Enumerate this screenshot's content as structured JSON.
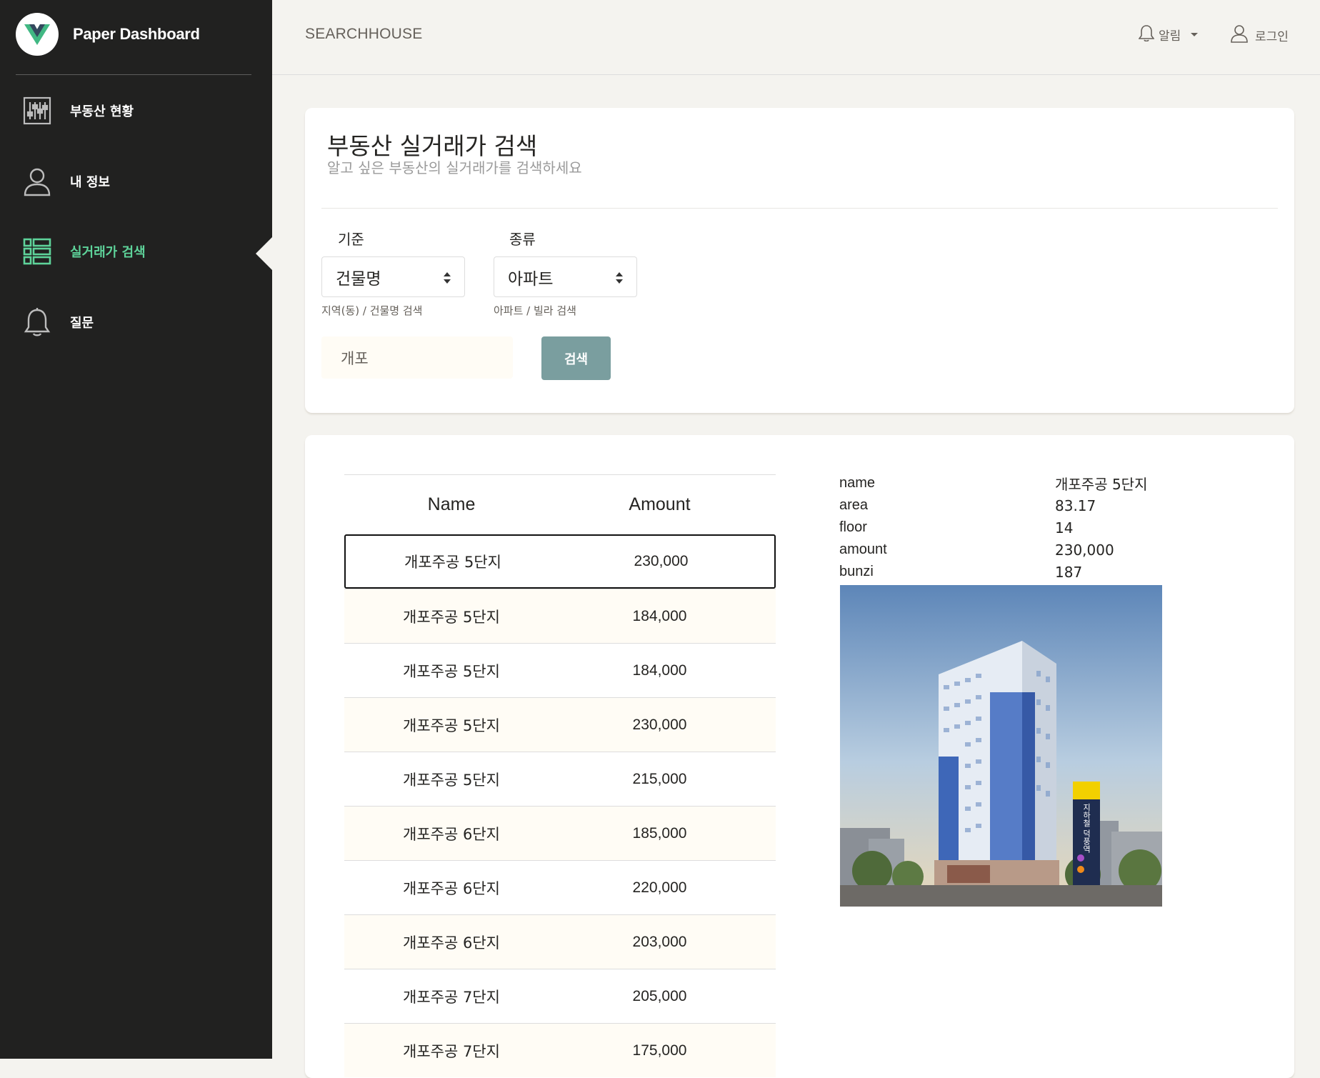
{
  "sidebar": {
    "brand": "Paper Dashboard",
    "items": [
      {
        "label": "부동산 현황",
        "icon": "dashboard-sliders-icon"
      },
      {
        "label": "내 정보",
        "icon": "user-icon"
      },
      {
        "label": "실거래가 검색",
        "icon": "list-icon"
      },
      {
        "label": "질문",
        "icon": "bell-icon"
      }
    ],
    "active_index": 2,
    "active_color": "#5ed39a"
  },
  "topbar": {
    "brand": "SEARCHHOUSE",
    "alarm_label": "알림",
    "login_label": "로그인"
  },
  "search_card": {
    "title": "부동산 실거래가 검색",
    "subtitle": "알고 싶은 부동산의 실거래가를 검색하세요",
    "criteria_label": "기준",
    "criteria_value": "건물명",
    "criteria_hint": "지역(동) / 건물명 검색",
    "type_label": "종류",
    "type_value": "아파트",
    "type_hint": "아파트 / 빌라 검색",
    "search_value": "개포",
    "search_button": "검색",
    "button_color": "#7a9e9f"
  },
  "results": {
    "headers": {
      "name": "Name",
      "amount": "Amount"
    },
    "rows": [
      {
        "name": "개포주공 5단지",
        "amount": "230,000"
      },
      {
        "name": "개포주공 5단지",
        "amount": "184,000"
      },
      {
        "name": "개포주공 5단지",
        "amount": "184,000"
      },
      {
        "name": "개포주공 5단지",
        "amount": "230,000"
      },
      {
        "name": "개포주공 5단지",
        "amount": "215,000"
      },
      {
        "name": "개포주공 6단지",
        "amount": "185,000"
      },
      {
        "name": "개포주공 6단지",
        "amount": "220,000"
      },
      {
        "name": "개포주공 6단지",
        "amount": "203,000"
      },
      {
        "name": "개포주공 7단지",
        "amount": "205,000"
      },
      {
        "name": "개포주공 7단지",
        "amount": "175,000"
      }
    ],
    "selected_index": 0
  },
  "details": {
    "rows": [
      {
        "key": "name",
        "value": "개포주공 5단지"
      },
      {
        "key": "area",
        "value": "83.17"
      },
      {
        "key": "floor",
        "value": "14"
      },
      {
        "key": "amount",
        "value": "230,000"
      },
      {
        "key": "bunzi",
        "value": "187"
      }
    ],
    "sign_text": "지하철 덕풍역"
  }
}
